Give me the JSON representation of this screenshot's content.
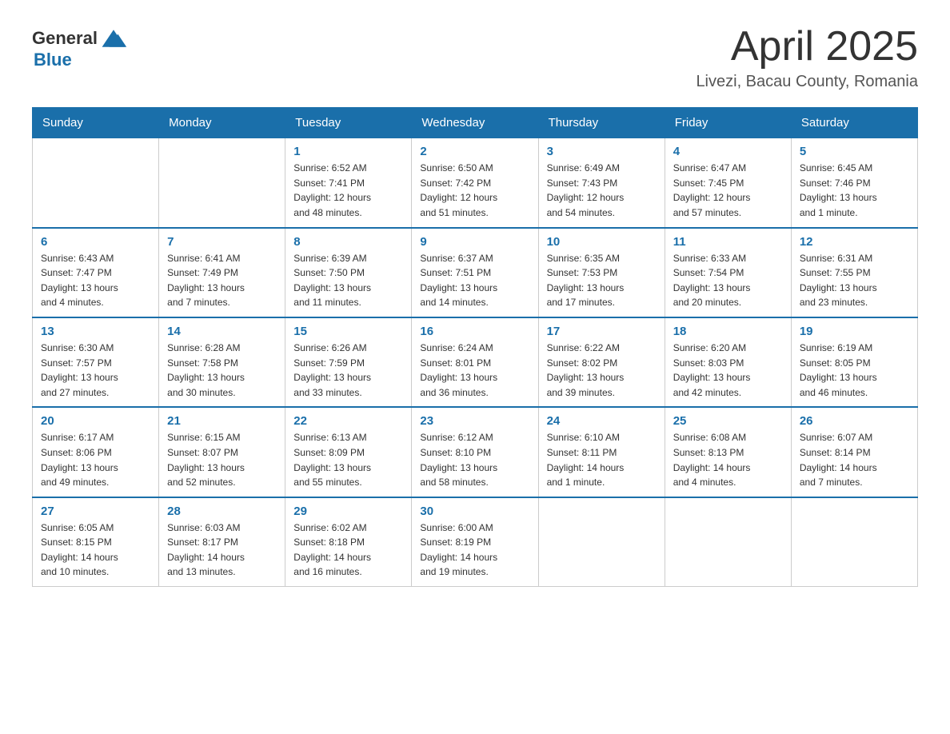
{
  "logo": {
    "text_general": "General",
    "text_blue": "Blue"
  },
  "header": {
    "month_year": "April 2025",
    "location": "Livezi, Bacau County, Romania"
  },
  "weekdays": [
    "Sunday",
    "Monday",
    "Tuesday",
    "Wednesday",
    "Thursday",
    "Friday",
    "Saturday"
  ],
  "weeks": [
    [
      {
        "day": "",
        "info": ""
      },
      {
        "day": "",
        "info": ""
      },
      {
        "day": "1",
        "info": "Sunrise: 6:52 AM\nSunset: 7:41 PM\nDaylight: 12 hours\nand 48 minutes."
      },
      {
        "day": "2",
        "info": "Sunrise: 6:50 AM\nSunset: 7:42 PM\nDaylight: 12 hours\nand 51 minutes."
      },
      {
        "day": "3",
        "info": "Sunrise: 6:49 AM\nSunset: 7:43 PM\nDaylight: 12 hours\nand 54 minutes."
      },
      {
        "day": "4",
        "info": "Sunrise: 6:47 AM\nSunset: 7:45 PM\nDaylight: 12 hours\nand 57 minutes."
      },
      {
        "day": "5",
        "info": "Sunrise: 6:45 AM\nSunset: 7:46 PM\nDaylight: 13 hours\nand 1 minute."
      }
    ],
    [
      {
        "day": "6",
        "info": "Sunrise: 6:43 AM\nSunset: 7:47 PM\nDaylight: 13 hours\nand 4 minutes."
      },
      {
        "day": "7",
        "info": "Sunrise: 6:41 AM\nSunset: 7:49 PM\nDaylight: 13 hours\nand 7 minutes."
      },
      {
        "day": "8",
        "info": "Sunrise: 6:39 AM\nSunset: 7:50 PM\nDaylight: 13 hours\nand 11 minutes."
      },
      {
        "day": "9",
        "info": "Sunrise: 6:37 AM\nSunset: 7:51 PM\nDaylight: 13 hours\nand 14 minutes."
      },
      {
        "day": "10",
        "info": "Sunrise: 6:35 AM\nSunset: 7:53 PM\nDaylight: 13 hours\nand 17 minutes."
      },
      {
        "day": "11",
        "info": "Sunrise: 6:33 AM\nSunset: 7:54 PM\nDaylight: 13 hours\nand 20 minutes."
      },
      {
        "day": "12",
        "info": "Sunrise: 6:31 AM\nSunset: 7:55 PM\nDaylight: 13 hours\nand 23 minutes."
      }
    ],
    [
      {
        "day": "13",
        "info": "Sunrise: 6:30 AM\nSunset: 7:57 PM\nDaylight: 13 hours\nand 27 minutes."
      },
      {
        "day": "14",
        "info": "Sunrise: 6:28 AM\nSunset: 7:58 PM\nDaylight: 13 hours\nand 30 minutes."
      },
      {
        "day": "15",
        "info": "Sunrise: 6:26 AM\nSunset: 7:59 PM\nDaylight: 13 hours\nand 33 minutes."
      },
      {
        "day": "16",
        "info": "Sunrise: 6:24 AM\nSunset: 8:01 PM\nDaylight: 13 hours\nand 36 minutes."
      },
      {
        "day": "17",
        "info": "Sunrise: 6:22 AM\nSunset: 8:02 PM\nDaylight: 13 hours\nand 39 minutes."
      },
      {
        "day": "18",
        "info": "Sunrise: 6:20 AM\nSunset: 8:03 PM\nDaylight: 13 hours\nand 42 minutes."
      },
      {
        "day": "19",
        "info": "Sunrise: 6:19 AM\nSunset: 8:05 PM\nDaylight: 13 hours\nand 46 minutes."
      }
    ],
    [
      {
        "day": "20",
        "info": "Sunrise: 6:17 AM\nSunset: 8:06 PM\nDaylight: 13 hours\nand 49 minutes."
      },
      {
        "day": "21",
        "info": "Sunrise: 6:15 AM\nSunset: 8:07 PM\nDaylight: 13 hours\nand 52 minutes."
      },
      {
        "day": "22",
        "info": "Sunrise: 6:13 AM\nSunset: 8:09 PM\nDaylight: 13 hours\nand 55 minutes."
      },
      {
        "day": "23",
        "info": "Sunrise: 6:12 AM\nSunset: 8:10 PM\nDaylight: 13 hours\nand 58 minutes."
      },
      {
        "day": "24",
        "info": "Sunrise: 6:10 AM\nSunset: 8:11 PM\nDaylight: 14 hours\nand 1 minute."
      },
      {
        "day": "25",
        "info": "Sunrise: 6:08 AM\nSunset: 8:13 PM\nDaylight: 14 hours\nand 4 minutes."
      },
      {
        "day": "26",
        "info": "Sunrise: 6:07 AM\nSunset: 8:14 PM\nDaylight: 14 hours\nand 7 minutes."
      }
    ],
    [
      {
        "day": "27",
        "info": "Sunrise: 6:05 AM\nSunset: 8:15 PM\nDaylight: 14 hours\nand 10 minutes."
      },
      {
        "day": "28",
        "info": "Sunrise: 6:03 AM\nSunset: 8:17 PM\nDaylight: 14 hours\nand 13 minutes."
      },
      {
        "day": "29",
        "info": "Sunrise: 6:02 AM\nSunset: 8:18 PM\nDaylight: 14 hours\nand 16 minutes."
      },
      {
        "day": "30",
        "info": "Sunrise: 6:00 AM\nSunset: 8:19 PM\nDaylight: 14 hours\nand 19 minutes."
      },
      {
        "day": "",
        "info": ""
      },
      {
        "day": "",
        "info": ""
      },
      {
        "day": "",
        "info": ""
      }
    ]
  ]
}
